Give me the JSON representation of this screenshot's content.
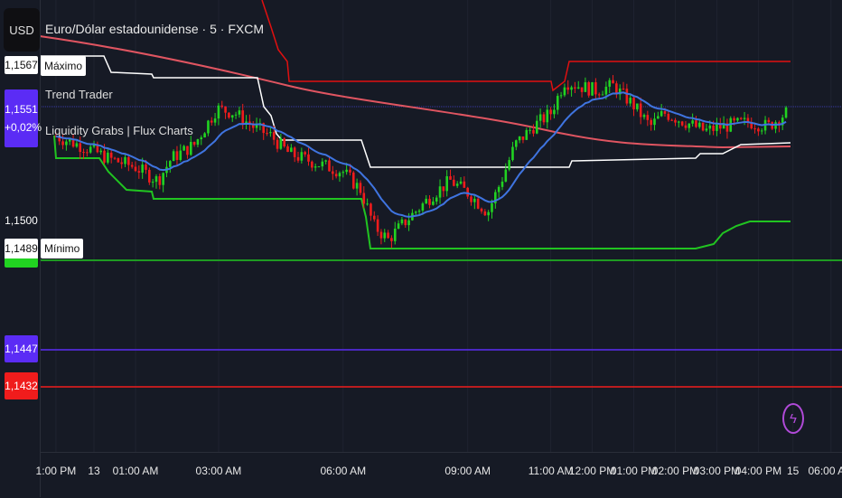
{
  "header": {
    "currency": "USD",
    "symbol_title": "Euro/Dólar estadounidense · 5 · FXCM",
    "indicators": [
      "Trend Trader",
      "Liquidity Grabs | Flux Charts"
    ]
  },
  "price_labels": {
    "max_price": "1,1567",
    "max_tag": "Máximo",
    "last_price": "1,1551",
    "change": "+0,02%",
    "level_1500": "1,1500",
    "min_price": "1,1489",
    "min_tag": "Mínimo",
    "purple_level": "1,1447",
    "red_level": "1,1432"
  },
  "colors": {
    "background": "#161a25",
    "up": "#21d321",
    "down": "#f01c1c",
    "last_price": "#5b2cf5",
    "purple_line": "#5b2cf5",
    "red_line": "#f01c1c",
    "ema_fast": "#3f74e0",
    "ema_slow": "#e05561",
    "bolt": "#b04ad8"
  },
  "chart_data": {
    "type": "candlestick",
    "title": "Euro/Dólar estadounidense · 5 · FXCM",
    "x_unit": "5-minute bar index (0 = 01:00 AM)",
    "xlim": [
      -28,
      204
    ],
    "ylim_labels": [
      "1,1500",
      "1,1447"
    ],
    "price_path": [
      [
        -23.5,
        1.15354
      ],
      [
        -13,
        1.15298
      ],
      [
        -8,
        1.15261
      ],
      [
        0,
        1.15224
      ],
      [
        6.5,
        1.15168
      ],
      [
        10.4,
        1.15261
      ],
      [
        17,
        1.15317
      ],
      [
        23.5,
        1.15466
      ],
      [
        28.7,
        1.15448
      ],
      [
        33.9,
        1.15392
      ],
      [
        39,
        1.15354
      ],
      [
        44.4,
        1.1528
      ],
      [
        52,
        1.15242
      ],
      [
        60,
        1.15205
      ],
      [
        65,
        1.15131
      ],
      [
        69,
        1.14981
      ],
      [
        73,
        1.14925
      ],
      [
        78,
        1.15
      ],
      [
        86,
        1.15112
      ],
      [
        91,
        1.15168
      ],
      [
        96.6,
        1.15112
      ],
      [
        101.8,
        1.15037
      ],
      [
        105.7,
        1.15168
      ],
      [
        109.7,
        1.15317
      ],
      [
        115,
        1.15392
      ],
      [
        120,
        1.15448
      ],
      [
        124,
        1.15578
      ],
      [
        128,
        1.1556
      ],
      [
        133,
        1.15541
      ],
      [
        138,
        1.1556
      ],
      [
        143.6,
        1.15485
      ],
      [
        148.8,
        1.15392
      ],
      [
        152.7,
        1.15448
      ],
      [
        159,
        1.1541
      ],
      [
        164.5,
        1.15373
      ],
      [
        169.7,
        1.15392
      ],
      [
        177.5,
        1.1541
      ],
      [
        182.8,
        1.15392
      ],
      [
        188,
        1.15448
      ]
    ],
    "x_ticks": [
      {
        "label": "1:00 PM",
        "idx": -23
      },
      {
        "label": "13",
        "idx": -12
      },
      {
        "label": "01:00 AM",
        "idx": 0
      },
      {
        "label": "03:00 AM",
        "idx": 24
      },
      {
        "label": "06:00 AM",
        "idx": 60
      },
      {
        "label": "09:00 AM",
        "idx": 96
      },
      {
        "label": "11:00 AM",
        "idx": 120
      },
      {
        "label": "12:00 PM",
        "idx": 132
      },
      {
        "label": "01:00 PM",
        "idx": 144
      },
      {
        "label": "02:00 PM",
        "idx": 156
      },
      {
        "label": "03:00 PM",
        "idx": 168
      },
      {
        "label": "04:00 PM",
        "idx": 180
      },
      {
        "label": "15",
        "idx": 190
      },
      {
        "label": "06:00 AM",
        "idx": 201
      }
    ],
    "horizontal_levels": [
      {
        "name": "minimo",
        "price": 1.1489
      },
      {
        "name": "purple",
        "price": 1.1447
      },
      {
        "name": "red",
        "price": 1.1432
      },
      {
        "name": "last",
        "price": 1.1551
      }
    ]
  }
}
